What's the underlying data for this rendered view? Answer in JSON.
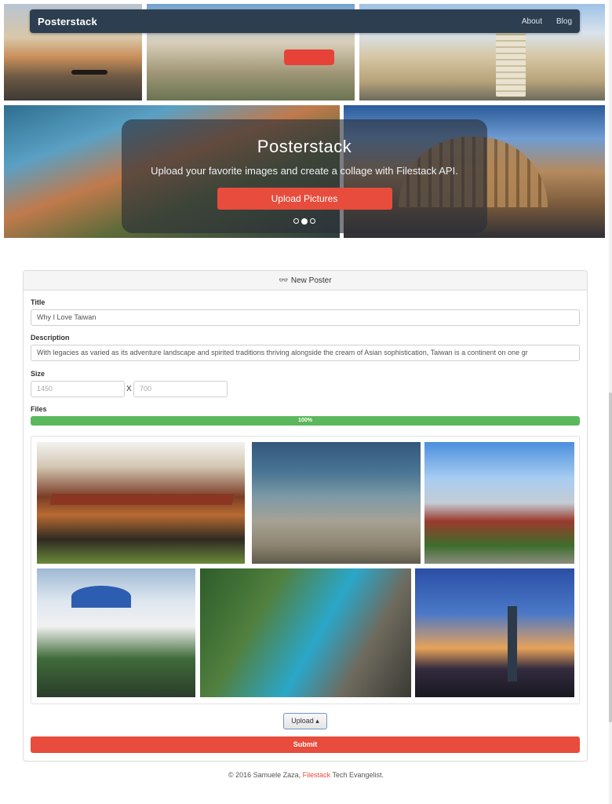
{
  "navbar": {
    "brand": "Posterstack",
    "links": [
      "About",
      "Blog"
    ]
  },
  "hero": {
    "title": "Posterstack",
    "subtitle": "Upload your favorite images and create a collage with Filestack API.",
    "cta": "Upload Pictures",
    "carousel": {
      "slides": 3,
      "active_index": 1
    }
  },
  "panel": {
    "header": {
      "icon": "👓",
      "title": "New Poster"
    },
    "title_label": "Title",
    "title_value": "Why I Love Taiwan",
    "description_label": "Description",
    "description_value": "With legacies as varied as its adventure landscape and spirited traditions thriving alongside the cream of Asian sophistication, Taiwan is a continent on one gr",
    "size_label": "Size",
    "width_placeholder": "1450",
    "size_separator": "X",
    "height_placeholder": "700",
    "files_label": "Files",
    "progress": {
      "percent": 100,
      "text": "100%",
      "color": "#5cb85c"
    },
    "images": [
      "temple-roof",
      "coast-fish-trap",
      "pagoda-skyline",
      "memorial-hall",
      "taroko-gorge",
      "taipei-101-night"
    ],
    "upload_button": "Upload ▴",
    "submit_button": "Submit"
  },
  "footer": {
    "prefix": "© 2016 Samuele Zaza, ",
    "link": "Filestack",
    "suffix": " Tech Evangelist."
  },
  "colors": {
    "navbar": "#2c3e50",
    "accent": "#e74c3c",
    "success": "#5cb85c"
  }
}
